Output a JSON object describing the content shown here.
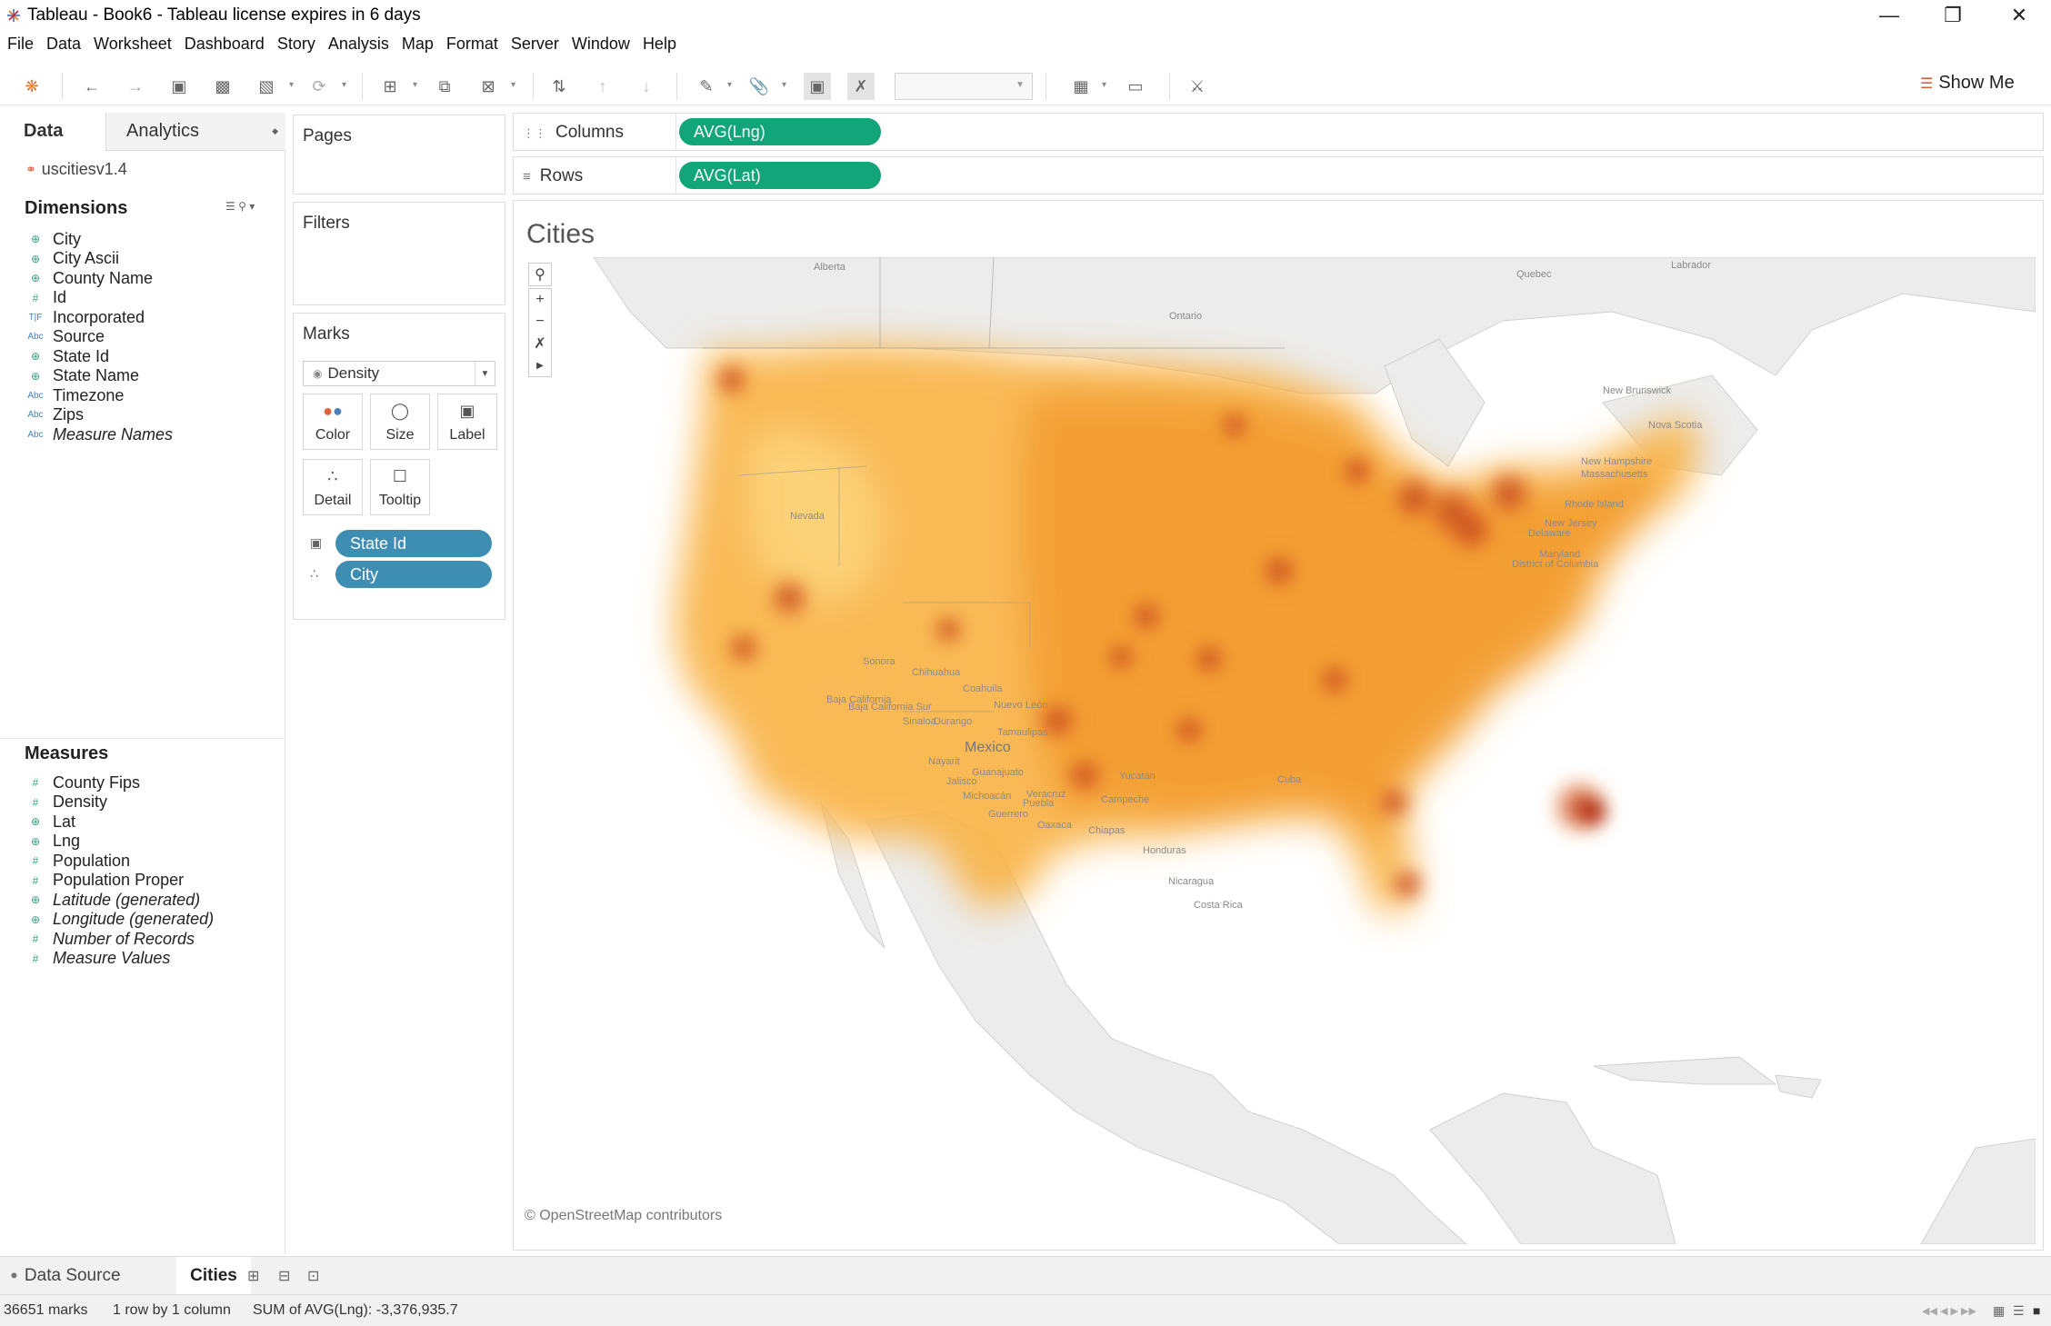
{
  "window": {
    "title": "Tableau - Book6 - Tableau license expires in 6 days"
  },
  "menu": [
    "File",
    "Data",
    "Worksheet",
    "Dashboard",
    "Story",
    "Analysis",
    "Map",
    "Format",
    "Server",
    "Window",
    "Help"
  ],
  "toolbar": {
    "show_me": "Show Me"
  },
  "data_pane": {
    "tab_data": "Data",
    "tab_analytics": "Analytics",
    "datasource": "uscitiesv1.4",
    "dimensions_header": "Dimensions",
    "dimensions": [
      {
        "label": "City",
        "icon": "globe-icon"
      },
      {
        "label": "City Ascii",
        "icon": "globe-icon"
      },
      {
        "label": "County Name",
        "icon": "globe-icon"
      },
      {
        "label": "Id",
        "icon": "hash-icon"
      },
      {
        "label": "Incorporated",
        "icon": "boolean-icon"
      },
      {
        "label": "Source",
        "icon": "abc-icon"
      },
      {
        "label": "State Id",
        "icon": "globe-icon"
      },
      {
        "label": "State Name",
        "icon": "globe-icon"
      },
      {
        "label": "Timezone",
        "icon": "abc-icon"
      },
      {
        "label": "Zips",
        "icon": "abc-icon"
      },
      {
        "label": "Measure Names",
        "icon": "abc-icon"
      }
    ],
    "measures_header": "Measures",
    "measures": [
      {
        "label": "County Fips",
        "icon": "hash-icon"
      },
      {
        "label": "Density",
        "icon": "hash-icon"
      },
      {
        "label": "Lat",
        "icon": "globe-icon"
      },
      {
        "label": "Lng",
        "icon": "globe-icon"
      },
      {
        "label": "Population",
        "icon": "hash-icon"
      },
      {
        "label": "Population Proper",
        "icon": "hash-icon"
      },
      {
        "label": "Latitude (generated)",
        "icon": "globe-icon"
      },
      {
        "label": "Longitude (generated)",
        "icon": "globe-icon"
      },
      {
        "label": "Number of Records",
        "icon": "hash-icon"
      },
      {
        "label": "Measure Values",
        "icon": "hash-icon"
      }
    ]
  },
  "cards": {
    "pages": "Pages",
    "filters": "Filters",
    "marks": "Marks",
    "mark_type": "Density",
    "mark_buttons": [
      "Color",
      "Size",
      "Label",
      "Detail",
      "Tooltip"
    ],
    "mark_pills": [
      "State Id",
      "City"
    ]
  },
  "shelves": {
    "columns_label": "Columns",
    "columns_pill": "AVG(Lng)",
    "rows_label": "Rows",
    "rows_pill": "AVG(Lat)"
  },
  "viz": {
    "title": "Cities",
    "attribution": "© OpenStreetMap contributors",
    "map_labels": [
      "Alberta",
      "Quebec",
      "Labrador",
      "Ontario",
      "New Brunswick",
      "Nova Scotia",
      "New Hampshire",
      "Massachusetts",
      "Rhode Island",
      "New Jersey",
      "Delaware",
      "Maryland",
      "District of Columbia",
      "Nevada",
      "Baja California",
      "Sonora",
      "Chihuahua",
      "Coahuila",
      "Nuevo León",
      "Baja California Sur",
      "Sinaloa",
      "Durango",
      "Tamaulipas",
      "Mexico",
      "Nayarit",
      "Guanajuato",
      "Jalisco",
      "Michoacán",
      "Veracruz",
      "Puebla",
      "Guerrero",
      "Oaxaca",
      "Chiapas",
      "Yucatán",
      "Campeche",
      "Cuba",
      "Honduras",
      "Nicaragua",
      "Costa Rica"
    ]
  },
  "bottom": {
    "data_source_tab": "Data Source",
    "sheet_tab": "Cities"
  },
  "status": {
    "marks": "36651 marks",
    "dims": "1 row by 1 column",
    "sum": "SUM of AVG(Lng): -3,376,935.7"
  }
}
